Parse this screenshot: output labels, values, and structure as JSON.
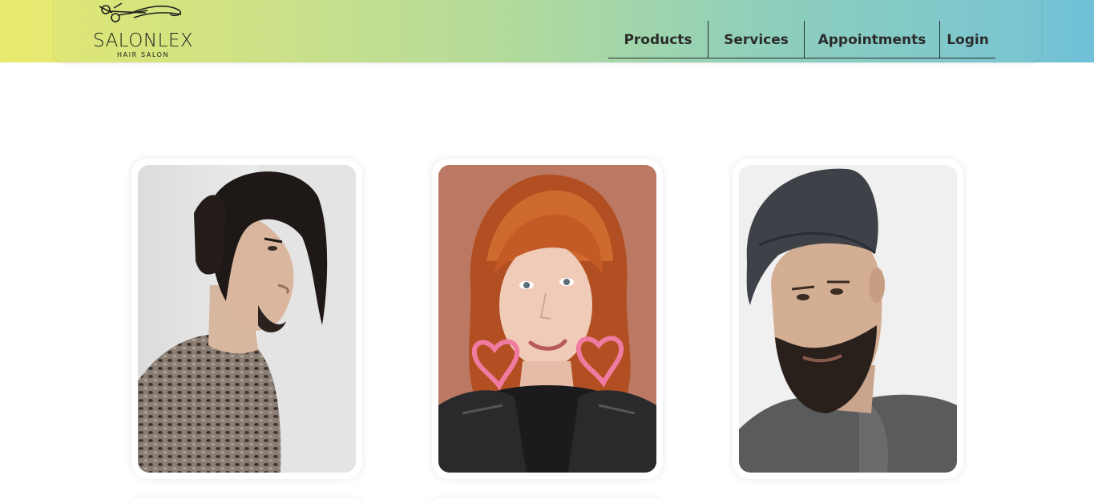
{
  "header": {
    "logo": {
      "wordmark": "SALONLEX",
      "subtitle": "HAIR SALON",
      "icon": "scissors-icon"
    },
    "nav": [
      {
        "label": "Products"
      },
      {
        "label": "Services"
      },
      {
        "label": "Appointments"
      },
      {
        "label": "Login"
      }
    ],
    "colors": {
      "gradient_start": "#e9ea6f",
      "gradient_end": "#6fc0d8",
      "text": "#2b2b2b"
    }
  },
  "gallery": {
    "cards": [
      {
        "subject": "long-haired-man-portrait"
      },
      {
        "subject": "red-haired-woman-portrait"
      },
      {
        "subject": "bearded-man-cap-portrait"
      }
    ]
  }
}
